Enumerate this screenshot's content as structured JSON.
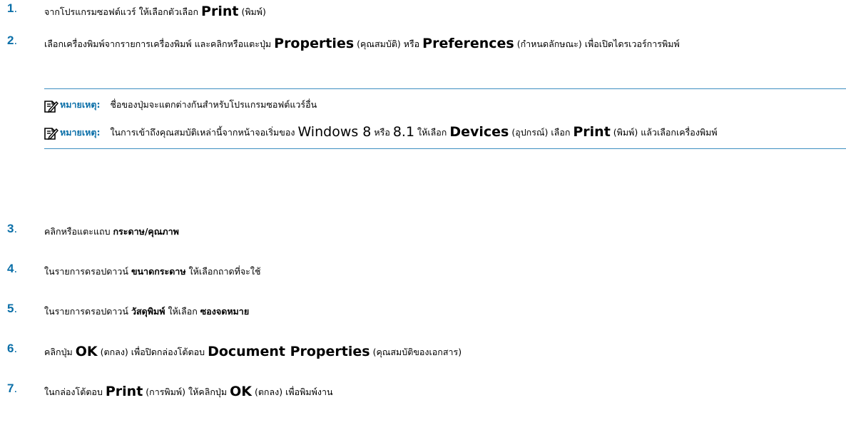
{
  "steps": [
    {
      "number": "1",
      "parts": [
        {
          "t": "text",
          "v": "จากโปรแกรมซอฟต์แวร์ ให้เลือกตัวเลือก "
        },
        {
          "t": "big",
          "v": "Print"
        },
        {
          "t": "text",
          "v": " (พิมพ์)"
        }
      ]
    },
    {
      "number": "2",
      "parts": [
        {
          "t": "text",
          "v": "เลือกเครื่องพิมพ์จากรายการเครื่องพิมพ์ และคลิกหรือแตะปุ่ม "
        },
        {
          "t": "big",
          "v": "Properties"
        },
        {
          "t": "text",
          "v": " (คุณสมบัติ) หรือ "
        },
        {
          "t": "big",
          "v": "Preferences"
        },
        {
          "t": "text",
          "v": " (กำหนดลักษณะ) เพื่อเปิดไดรเวอร์การพิมพ์"
        }
      ]
    }
  ],
  "notes": [
    {
      "label": "หมายเหตุ:",
      "icon": "note-pencil-icon",
      "parts": [
        {
          "t": "text",
          "v": "ชื่อของปุ่มจะแตกต่างกันสำหรับโปรแกรมซอฟต์แวร์อื่น"
        }
      ]
    },
    {
      "label": "หมายเหตุ:",
      "icon": "note-pencil-icon",
      "parts": [
        {
          "t": "text",
          "v": "ในการเข้าถึงคุณสมบัติเหล่านี้จากหน้าจอเริ่มของ "
        },
        {
          "t": "medium",
          "v": "Windows 8"
        },
        {
          "t": "text",
          "v": " หรือ "
        },
        {
          "t": "medium",
          "v": "8.1"
        },
        {
          "t": "text",
          "v": " ให้เลือก "
        },
        {
          "t": "big",
          "v": "Devices"
        },
        {
          "t": "text",
          "v": " (อุปกรณ์) เลือก "
        },
        {
          "t": "big",
          "v": "Print"
        },
        {
          "t": "text",
          "v": " (พิมพ์) แล้วเลือกเครื่องพิมพ์"
        }
      ]
    }
  ],
  "steps_after": [
    {
      "number": "3",
      "parts": [
        {
          "t": "text",
          "v": "คลิกหรือแตะแถบ "
        },
        {
          "t": "bold",
          "v": "กระดาษ/คุณภาพ"
        }
      ]
    },
    {
      "number": "4",
      "parts": [
        {
          "t": "text",
          "v": "ในรายการดรอปดาวน์ "
        },
        {
          "t": "bold",
          "v": "ขนาดกระดาษ"
        },
        {
          "t": "text",
          "v": " ให้เลือกถาดที่จะใช้"
        }
      ]
    },
    {
      "number": "5",
      "parts": [
        {
          "t": "text",
          "v": "ในรายการดรอปดาวน์ "
        },
        {
          "t": "bold",
          "v": "วัสดุพิมพ์"
        },
        {
          "t": "text",
          "v": " ให้เลือก "
        },
        {
          "t": "bold",
          "v": "ซองจดหมาย"
        }
      ]
    },
    {
      "number": "6",
      "parts": [
        {
          "t": "text",
          "v": "คลิกปุ่ม "
        },
        {
          "t": "big",
          "v": "OK"
        },
        {
          "t": "text",
          "v": " (ตกลง) เพื่อปิดกล่องโต้ตอบ "
        },
        {
          "t": "big",
          "v": "Document Properties"
        },
        {
          "t": "text",
          "v": " (คุณสมบัติของเอกสาร)"
        }
      ]
    },
    {
      "number": "7",
      "parts": [
        {
          "t": "text",
          "v": "ในกล่องโต้ตอบ "
        },
        {
          "t": "big",
          "v": "Print"
        },
        {
          "t": "text",
          "v": " (การพิมพ์) ให้คลิกปุ่ม "
        },
        {
          "t": "big",
          "v": "OK"
        },
        {
          "t": "text",
          "v": " (ตกลง) เพื่อพิมพ์งาน"
        }
      ]
    }
  ],
  "colors": {
    "accent": "#0b6fa8",
    "rule": "#3d8ec0"
  }
}
